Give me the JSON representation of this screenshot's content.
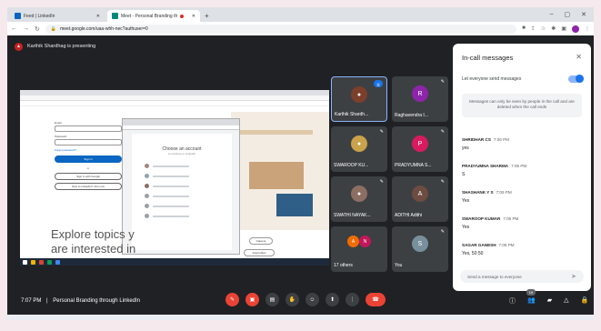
{
  "browser": {
    "tabs": [
      {
        "label": "Feed | LinkedIn",
        "favicon_color": "#0a66c2"
      },
      {
        "label": "Meet - Personal Branding th",
        "favicon_color": "#00897b"
      }
    ],
    "url": "meet.google.com/uaa-whh-nec?authuser=0"
  },
  "meeting": {
    "presenter_banner": "Karthik Shardhag is presenting",
    "time": "7:07 PM",
    "separator": "|",
    "title": "Personal Branding through LinkedIn",
    "people_count": "19"
  },
  "shared_screen": {
    "email_label": "Email",
    "password_label": "Password",
    "forgot_link": "Forgot password?",
    "sign_in": "Sign in",
    "or_text": "or",
    "google_button": "Sign in with Google",
    "new_button": "New to LinkedIn? Join now",
    "chooser_title": "Choose an account",
    "chooser_subtitle": "to continue to LinkedIn",
    "headline_line1": "Explore topics y",
    "headline_line2": "are interested in",
    "pill_careers": "Careers",
    "pill_internships": "Internships"
  },
  "participants": [
    {
      "name": "Karthik Shardh...",
      "initial": "",
      "color": "#7b3f2a",
      "kind": "photo",
      "active": true
    },
    {
      "name": "Raghavendra I...",
      "initial": "R",
      "color": "#8e24aa",
      "kind": "initial"
    },
    {
      "name": "SWAROOP KU...",
      "initial": "",
      "color": "#c9a24a",
      "kind": "photo"
    },
    {
      "name": "PRADYUMNA S...",
      "initial": "P",
      "color": "#d81b60",
      "kind": "initial"
    },
    {
      "name": "SWATHI NAYAK...",
      "initial": "",
      "color": "#8d6e63",
      "kind": "photo"
    },
    {
      "name": "ADITHI Adithi",
      "initial": "A",
      "color": "#6d4c41",
      "kind": "initial"
    },
    {
      "name": "17 others",
      "initial": "",
      "color": "#e64a19",
      "kind": "others"
    },
    {
      "name": "You",
      "initial": "S",
      "color": "#78909c",
      "kind": "initial"
    }
  ],
  "others_avatars": [
    {
      "initial": "A",
      "color": "#ef6c00"
    },
    {
      "initial": "N",
      "color": "#c2185b"
    }
  ],
  "chat": {
    "title": "In-call messages",
    "toggle_label": "Let everyone send messages",
    "notice": "Messages can only be seen by people in the call and are deleted when the call ends",
    "messages": [
      {
        "sender": "SHRIDHAR CS",
        "time": "7:06 PM",
        "text": "yes"
      },
      {
        "sender": "PRADYUMNA SHARMA",
        "time": "7:06 PM",
        "text": "S"
      },
      {
        "sender": "SHASHANK Y S",
        "time": "7:06 PM",
        "text": "Yes"
      },
      {
        "sender": "SWAROOP KUMAR",
        "time": "7:06 PM",
        "text": "Yes"
      },
      {
        "sender": "SAGAR GANESH",
        "time": "7:06 PM",
        "text": "Yes, 50 50"
      }
    ],
    "input_placeholder": "Send a message to everyone"
  },
  "colors": {
    "meet_bg": "#202124",
    "tile_bg": "#3c4043",
    "accent_blue": "#1a73e8",
    "end_red": "#ea4335"
  }
}
